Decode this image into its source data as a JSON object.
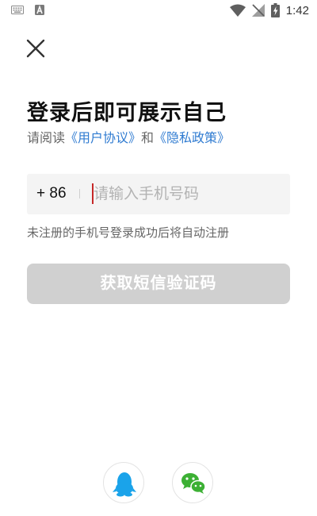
{
  "status_bar": {
    "time": "1:42",
    "left_icons": [
      "keyboard-icon",
      "a-letter-icon"
    ],
    "right_icons": [
      "wifi-icon",
      "no-signal-icon",
      "battery-charging-icon"
    ]
  },
  "page": {
    "title": "登录后即可展示自己",
    "agreement": {
      "prefix": "请阅读",
      "user_agreement": "《用户协议》",
      "joiner": "和",
      "privacy_policy": "《隐私政策》"
    },
    "phone": {
      "country_code": "+ 86",
      "placeholder": "请输入手机号码",
      "value": ""
    },
    "hint": "未注册的手机号登录成功后将自动注册",
    "sms_button": "获取短信验证码"
  },
  "social_login": [
    {
      "name": "qq",
      "icon": "qq-penguin-icon",
      "color": "#1aa3ea"
    },
    {
      "name": "wechat",
      "icon": "wechat-icon",
      "color": "#3cb034"
    }
  ],
  "colors": {
    "link": "#2f7bd1",
    "button_disabled": "#d0d0d0",
    "input_bg": "#f4f4f4",
    "caret": "#c62828"
  }
}
